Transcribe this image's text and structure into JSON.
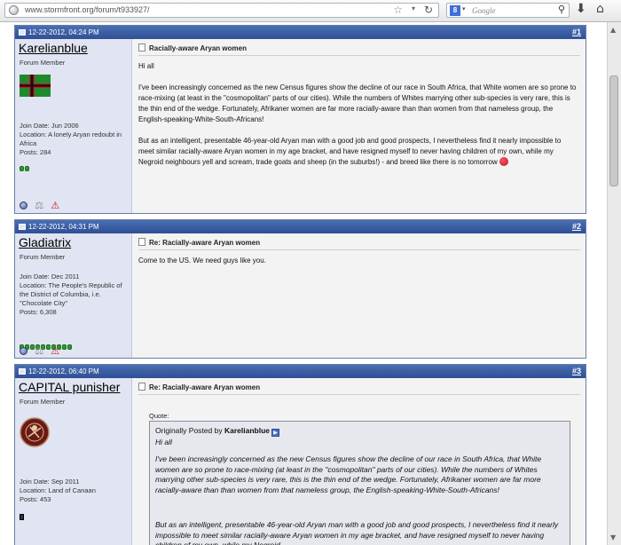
{
  "browser": {
    "url": "www.stormfront.org/forum/t933927/",
    "search_engine_label": "8",
    "search_placeholder": "Google"
  },
  "posts": [
    {
      "date": "12-22-2012, 04:24 PM",
      "number": "#1",
      "username": "Karelianblue",
      "user_title": "Forum Member",
      "join_date": "Join Date: Jun 2006",
      "location": "Location: A lonely Aryan redoubt in Africa",
      "posts_count": "Posts: 284",
      "title": "Racially-aware Aryan women",
      "body": [
        "Hi all",
        "I've been increasingly concerned as the new Census figures show the decline of our race in South Africa, that White women are so prone to race-mixing (at least in the \"cosmopolitan\" parts of our cities). While the numbers of Whites marrying other sub-species is very rare, this is the thin end of the wedge. Fortunately, Afrikaner women are far more racially-aware than than women from that nameless group, the English-speaking-White-South-Africans!",
        "But as an intelligent, presentable 46-year-old Aryan man with a good job and good prospects, I nevertheless find it nearly impossible to meet similar racially-aware Aryan women in my age bracket, and have resigned myself to never having children of my own, while my Negroid neighbours yell and scream, trade goats and sheep (in the suburbs!) - and breed like there is no tomorrow"
      ]
    },
    {
      "date": "12-22-2012, 04:31 PM",
      "number": "#2",
      "username": "Gladiatrix",
      "user_title": "Forum Member",
      "join_date": "Join Date: Dec 2011",
      "location": "Location: The People's Republic of the District of Columbia, i.e. \"Chocolate City\"",
      "posts_count": "Posts: 6,308",
      "title": "Re: Racially-aware Aryan women",
      "body": [
        "Come to the US. We need guys like you."
      ]
    },
    {
      "date": "12-22-2012, 06:40 PM",
      "number": "#3",
      "username": "CAPITAL punisher",
      "user_title": "Forum Member",
      "join_date": "Join Date: Sep 2011",
      "location": "Location: Land of Canaan",
      "posts_count": "Posts: 453",
      "title": "Re: Racially-aware Aryan women",
      "quote_label": "Quote:",
      "quote_prefix": "Originally Posted by",
      "quote_author": "Karelianblue",
      "quote_body": [
        "Hi all",
        "I've been increasingly concerned as the new Census figures show the decline of our race in South Africa, that White women are so prone to race-mixing (at least in the \"cosmopolitan\" parts of our cities). While the numbers of Whites marrying other sub-species is very rare, this is the thin end of the wedge. Fortunately, Afrikaner women are far more racially-aware than than women from that nameless group, the English-speaking-White-South-Africans!",
        "But as an intelligent, presentable 46-year-old Aryan man with a good job and good prospects, I nevertheless find it nearly impossible to meet similar racially-aware Aryan women in my age bracket, and have resigned myself to never having children of my own, while my Negroid"
      ]
    }
  ],
  "icons": {
    "online": "online-status-icon",
    "reputation": "reputation-icon",
    "report": "report-warning-icon"
  },
  "colors": {
    "header_blue": "#3a5ba0",
    "user_pane": "#e1e4f2",
    "rep_green": "#2d9b2d"
  }
}
